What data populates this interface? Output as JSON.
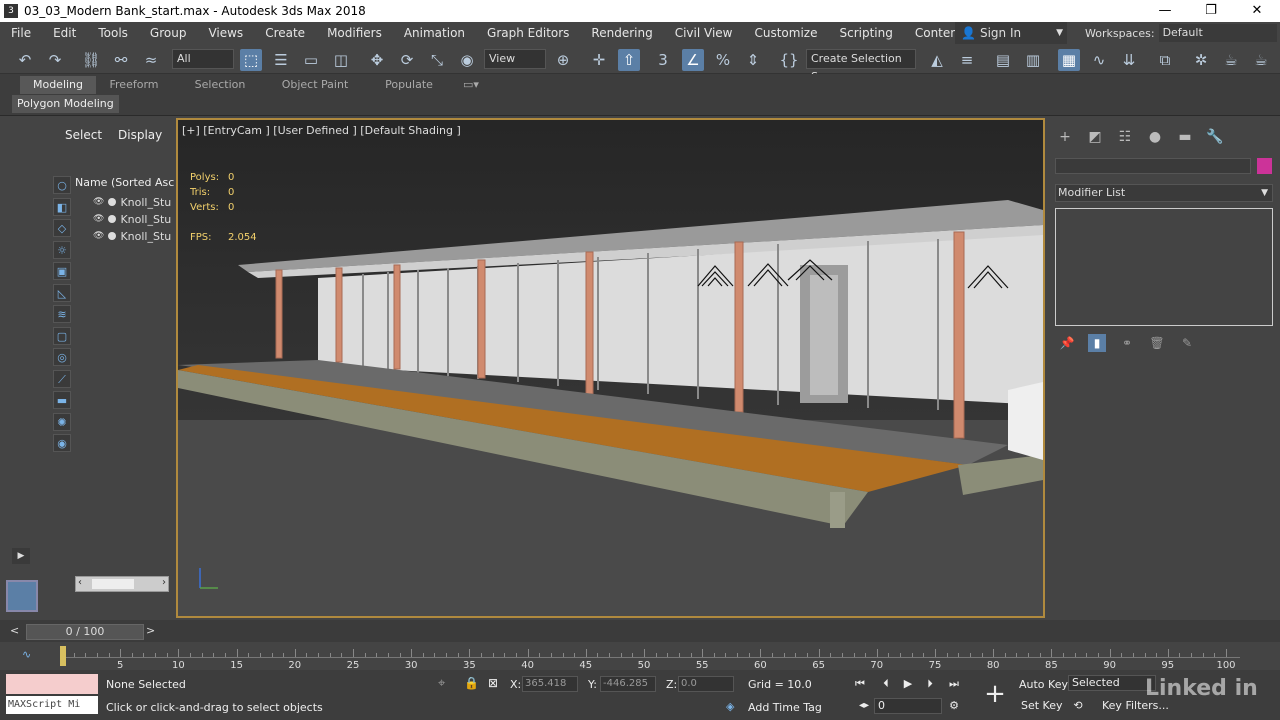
{
  "window": {
    "title": "03_03_Modern Bank_start.max - Autodesk 3ds Max 2018",
    "minimize": "—",
    "maximize": "❐",
    "close": "✕"
  },
  "menu": {
    "items": [
      "File",
      "Edit",
      "Tools",
      "Group",
      "Views",
      "Create",
      "Modifiers",
      "Animation",
      "Graph Editors",
      "Rendering",
      "Civil View",
      "Customize",
      "Scripting",
      "Content"
    ],
    "sign_in": "Sign In",
    "workspaces_label": "Workspaces:",
    "workspaces_value": "Default"
  },
  "toolbar": {
    "selection_filter": "All",
    "reference_coord": "View",
    "named_selection": "Create Selection Se"
  },
  "ribbon": {
    "tabs": [
      "Modeling",
      "Freeform",
      "Selection",
      "Object Paint",
      "Populate"
    ],
    "active_tab": "Modeling",
    "panel": "Polygon Modeling"
  },
  "scene_explorer": {
    "tabs": [
      "Select",
      "Display"
    ],
    "column_header": "Name (Sorted Ascen",
    "rows": [
      "Knoll_Stu",
      "Knoll_Stu",
      "Knoll_Stu"
    ]
  },
  "viewport": {
    "label": "[+] [EntryCam ] [User Defined ] [Default Shading ]",
    "stats": {
      "polys_label": "Polys:",
      "polys": "0",
      "tris_label": "Tris:",
      "tris": "0",
      "verts_label": "Verts:",
      "verts": "0",
      "fps_label": "FPS:",
      "fps": "2.054"
    }
  },
  "command_panel": {
    "modifier_list": "Modifier List",
    "object_color": "#cc3399"
  },
  "timeline": {
    "slider": "0 / 100",
    "ticks": [
      5,
      10,
      15,
      20,
      25,
      30,
      35,
      40,
      45,
      50,
      55,
      60,
      65,
      70,
      75,
      80,
      85,
      90,
      95,
      100
    ]
  },
  "status": {
    "maxscript": "MAXScript Mi",
    "selection": "None Selected",
    "prompt": "Click or click-and-drag to select objects",
    "x_label": "X:",
    "x": "365.418",
    "y_label": "Y:",
    "y": "-446.285",
    "z_label": "Z:",
    "z": "0.0",
    "grid": "Grid = 10.0",
    "add_time_tag": "Add Time Tag",
    "auto_key": "Auto Key",
    "set_key": "Set Key",
    "key_mode": "Selected",
    "key_filters": "Key Filters...",
    "frame": "0"
  },
  "watermark": "Linked in"
}
